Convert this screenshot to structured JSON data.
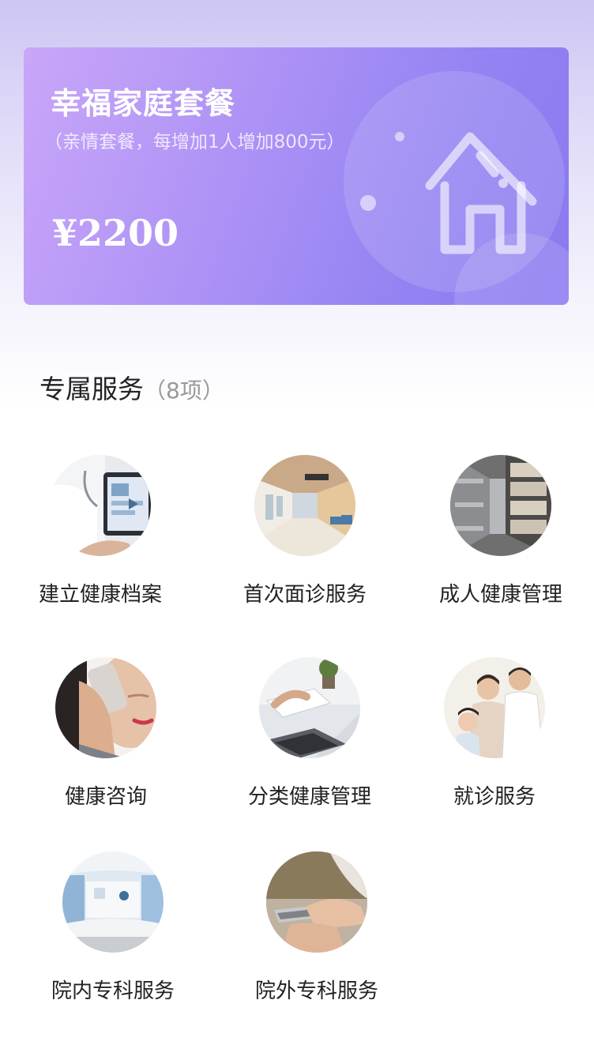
{
  "package": {
    "title": "幸福家庭套餐",
    "subtitle": "（亲情套餐，每增加1人增加800元）",
    "price": "¥2200",
    "icon": "house-icon"
  },
  "services_section": {
    "title": "专属服务",
    "count": "（8项）"
  },
  "services": [
    {
      "label": "建立健康档案",
      "image": "doctor-tablet-photo"
    },
    {
      "label": "首次面诊服务",
      "image": "hospital-corridor-photo"
    },
    {
      "label": "成人健康管理",
      "image": "records-shelves-photo"
    },
    {
      "label": "健康咨询",
      "image": "phone-call-photo"
    },
    {
      "label": "分类健康管理",
      "image": "laptop-desk-photo"
    },
    {
      "label": "就诊服务",
      "image": "family-doctor-photo"
    },
    {
      "label": "院内专科服务",
      "image": "hospital-reception-photo"
    },
    {
      "label": "院外专科服务",
      "image": "smartphone-hand-photo"
    }
  ]
}
